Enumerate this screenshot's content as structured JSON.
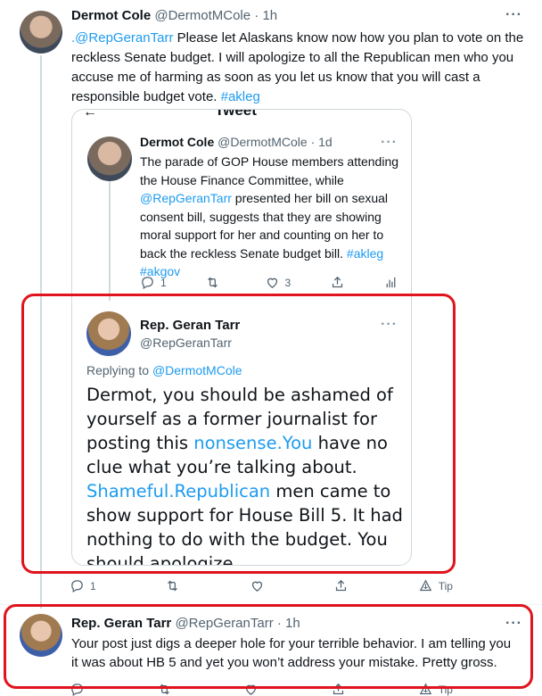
{
  "tweet1": {
    "author_name": "Dermot Cole",
    "author_handle": "@DermotMCole",
    "time": "· 1h",
    "mention": ".@RepGeranTarr",
    "text": " Please let Alaskans know now how you plan to vote on the reckless Senate budget. I will apologize to all the Republican men who you accuse me of harming as soon as you let us know that you will cast a responsible budget vote. ",
    "hashtag": "#akleg",
    "more": "···"
  },
  "quote": {
    "header_partial": "Tweet",
    "back_icon": "back-arrow-icon",
    "inner_tweet": {
      "author_name": "Dermot Cole",
      "author_handle": "@DermotMCole",
      "time": "· 1d",
      "text_a": "The parade of GOP House members attending the House Finance Committee, while ",
      "mention": "@RepGeranTarr",
      "text_b": " presented her bill on sexual consent bill, suggests that they are showing moral support for her and counting on her to back the reckless Senate budget bill. ",
      "hashtag1": "#akleg",
      "hashtag2": "#akgov",
      "replies": "1",
      "retweets": "",
      "likes": "3",
      "more": "···"
    },
    "reply_tweet": {
      "author_name": "Rep. Geran Tarr",
      "author_handle": "@RepGeranTarr",
      "replying_to_label": "Replying to ",
      "replying_to_handle": "@DermotMCole",
      "line1": "Dermot, you should be ashamed of",
      "line2": "yourself as a former journalist for",
      "line3_a": "posting this ",
      "line3_link": "nonsense.You",
      "line3_b": " have no",
      "line4": "clue what you’re talking about.",
      "line5_link": "Shameful.Republican",
      "line5_b": " men came to",
      "line6": "show support for House Bill 5. It had",
      "line7": "nothing to do with the budget. You",
      "line8": "should apologize.",
      "more": "···"
    }
  },
  "tweet1_actions": {
    "replies": "1",
    "retweets": "",
    "likes": "",
    "tip": "Tip"
  },
  "tweet2": {
    "author_name": "Rep. Geran Tarr",
    "author_handle": "@RepGeranTarr",
    "time": "· 1h",
    "text": "Your post just digs a deeper hole for your terrible behavior. I am telling you it was about HB 5 and yet you won’t address your mistake. Pretty gross.",
    "more": "···",
    "tip": "Tip"
  },
  "colors": {
    "accent": "#1d9bf0",
    "highlight_box": "#e0141e",
    "muted": "#536471"
  }
}
